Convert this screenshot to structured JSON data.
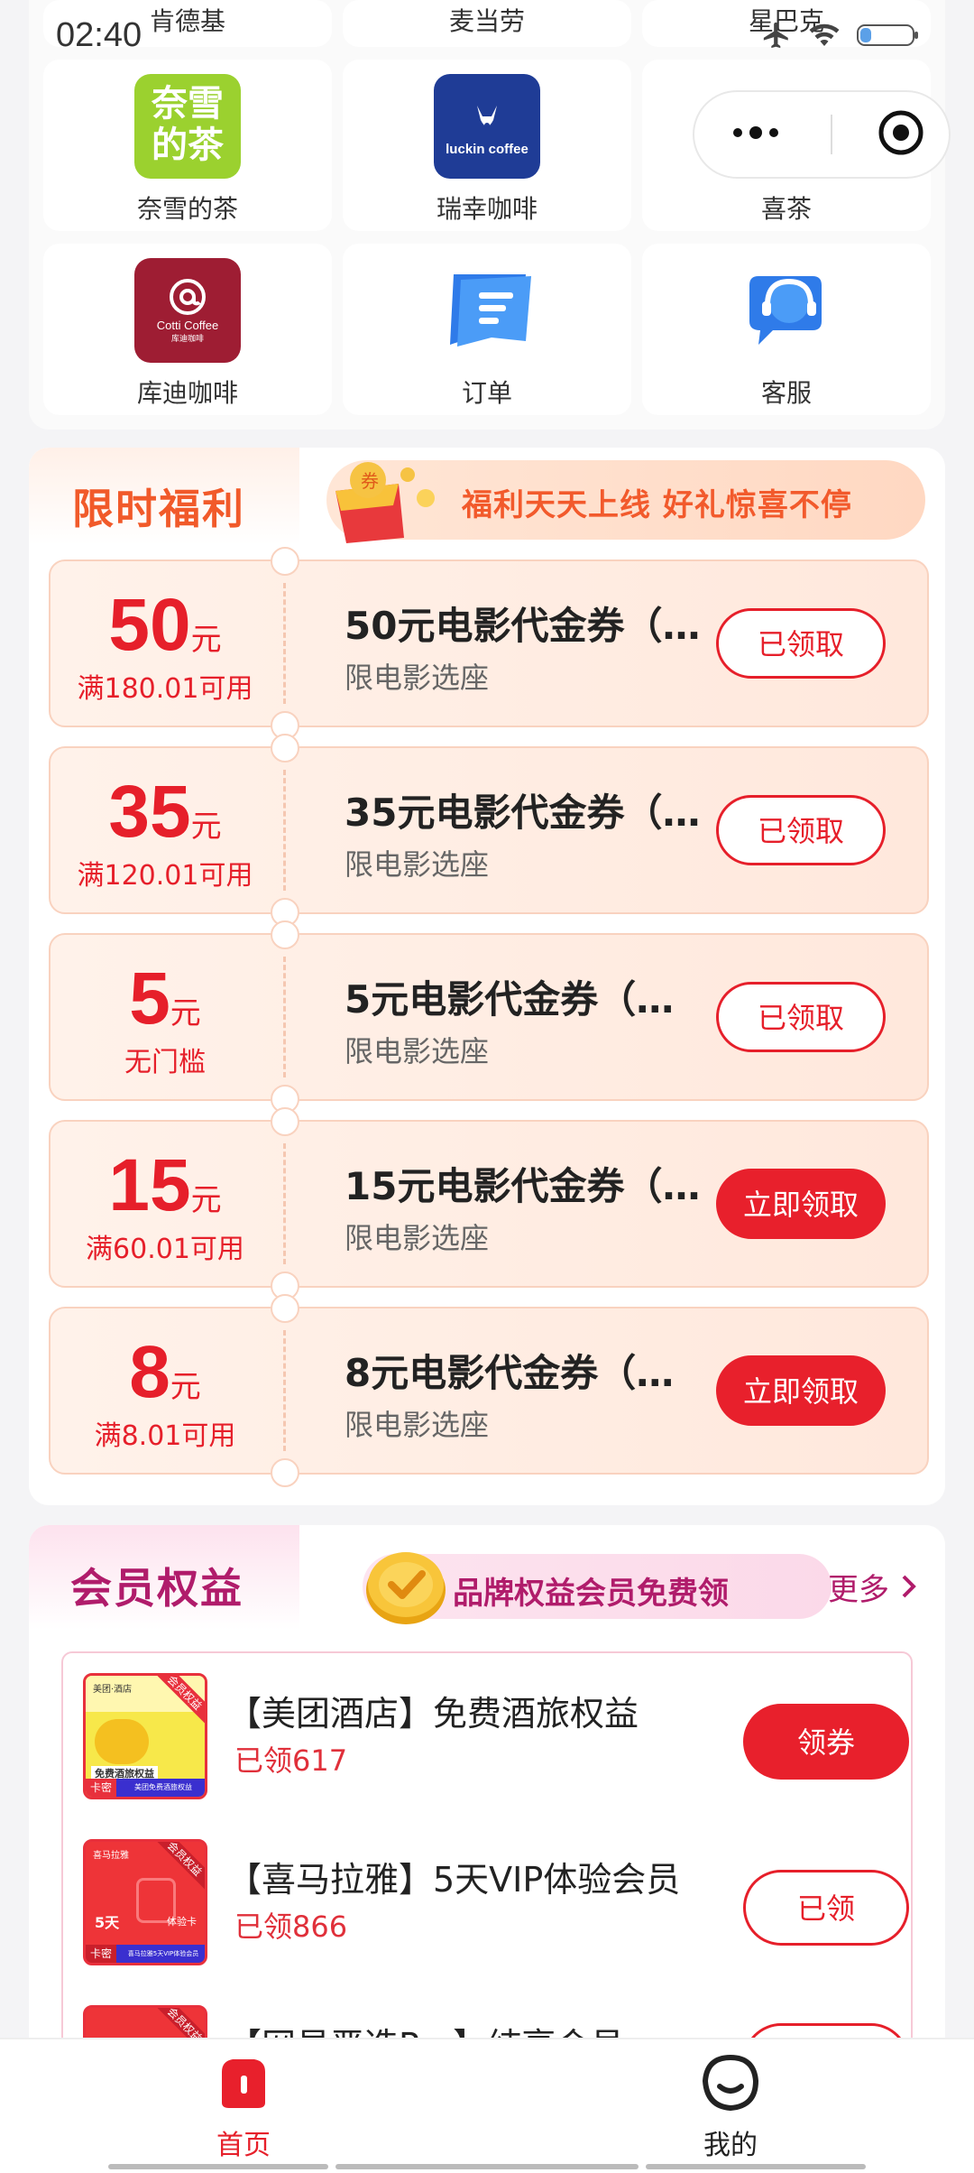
{
  "status_bar": {
    "time": "02:40"
  },
  "brands_top_row": [
    "肯德基",
    "麦当劳",
    "星巴克"
  ],
  "brands": [
    {
      "label": "奈雪的茶",
      "logo_text": "奈雪的茶",
      "icon": "naixue-logo"
    },
    {
      "label": "瑞幸咖啡",
      "logo_text": "luckin coffee",
      "icon": "luckin-logo"
    },
    {
      "label": "喜茶",
      "icon": "heytea-logo"
    },
    {
      "label": "库迪咖啡",
      "logo_text": "Cotti Coffee",
      "logo_sub": "库迪咖啡",
      "icon": "cotti-logo"
    },
    {
      "label": "订单",
      "icon": "order-icon"
    },
    {
      "label": "客服",
      "icon": "customer-service-icon"
    }
  ],
  "welfare": {
    "title": "限时福利",
    "slogan": "福利天天上线 好礼惊喜不停",
    "coupons": [
      {
        "amount": "50",
        "unit": "元",
        "condition": "满180.01可用",
        "title": "50元电影代金券（…",
        "subtitle": "限电影选座",
        "button": "已领取",
        "claimed": true
      },
      {
        "amount": "35",
        "unit": "元",
        "condition": "满120.01可用",
        "title": "35元电影代金券（…",
        "subtitle": "限电影选座",
        "button": "已领取",
        "claimed": true
      },
      {
        "amount": "5",
        "unit": "元",
        "condition": "无门槛",
        "title": "5元电影代金券（…",
        "subtitle": "限电影选座",
        "button": "已领取",
        "claimed": true
      },
      {
        "amount": "15",
        "unit": "元",
        "condition": "满60.01可用",
        "title": "15元电影代金券（…",
        "subtitle": "限电影选座",
        "button": "立即领取",
        "claimed": false
      },
      {
        "amount": "8",
        "unit": "元",
        "condition": "满8.01可用",
        "title": "8元电影代金券（…",
        "subtitle": "限电影选座",
        "button": "立即领取",
        "claimed": false
      }
    ]
  },
  "member": {
    "title": "会员权益",
    "slogan": "品牌权益会员免费领",
    "more": "更多",
    "items": [
      {
        "name": "【美团酒店】免费酒旅权益",
        "count": "已领617",
        "button": "领券",
        "claimed": false,
        "card_tag": "卡密",
        "card_text": "免费酒旅权益",
        "card_bottom": "美团免费酒旅权益",
        "card_corner": "会员权益"
      },
      {
        "name": "【喜马拉雅】5天VIP体验会员",
        "count": "已领866",
        "button": "已领",
        "claimed": true,
        "card_tag": "卡密",
        "card_text": "5天",
        "card_text2": "体验卡",
        "card_bottom": "喜马拉雅5天VIP体验会员",
        "card_corner": "会员权益"
      },
      {
        "name": "【网易严选Pro】纯享会员",
        "count": "",
        "button": "",
        "claimed": true,
        "card_corner": "会员权益"
      }
    ]
  },
  "bottom_nav": [
    {
      "label": "首页",
      "active": true,
      "icon": "home-icon"
    },
    {
      "label": "我的",
      "active": false,
      "icon": "profile-icon"
    }
  ],
  "colors": {
    "primary_red": "#e61f2a",
    "welfare_orange": "#f15a2a",
    "member_magenta": "#b01c6b"
  }
}
